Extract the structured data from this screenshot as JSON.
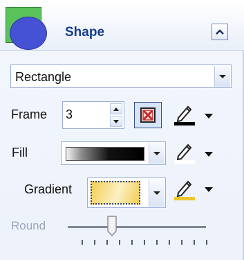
{
  "panel": {
    "title": "Shape",
    "collapse_icon": "chevron-up-icon",
    "shape_icon": "shape-icon"
  },
  "shape_select": {
    "value": "Rectangle",
    "icon": "chevron-down-icon"
  },
  "frame": {
    "label": "Frame",
    "width_value": "3",
    "no_frame_icon": "no-frame-icon",
    "pen_icon": "pen-icon",
    "pen_color": "#000000"
  },
  "fill": {
    "label": "Fill",
    "swatch_type": "gradient",
    "pen_icon": "pen-icon",
    "pen_color": "#ffffff"
  },
  "gradient": {
    "label": "Gradient",
    "colors": [
      "#f2cf57",
      "#fbf0c3"
    ],
    "pen_icon": "pen-icon",
    "pen_color": "#f0c42c"
  },
  "round": {
    "label": "Round",
    "value_fraction": 0.32,
    "tick_count": 11,
    "enabled": false
  },
  "colors": {
    "title": "#173c8a",
    "accent_border": "#9bb0d4"
  }
}
